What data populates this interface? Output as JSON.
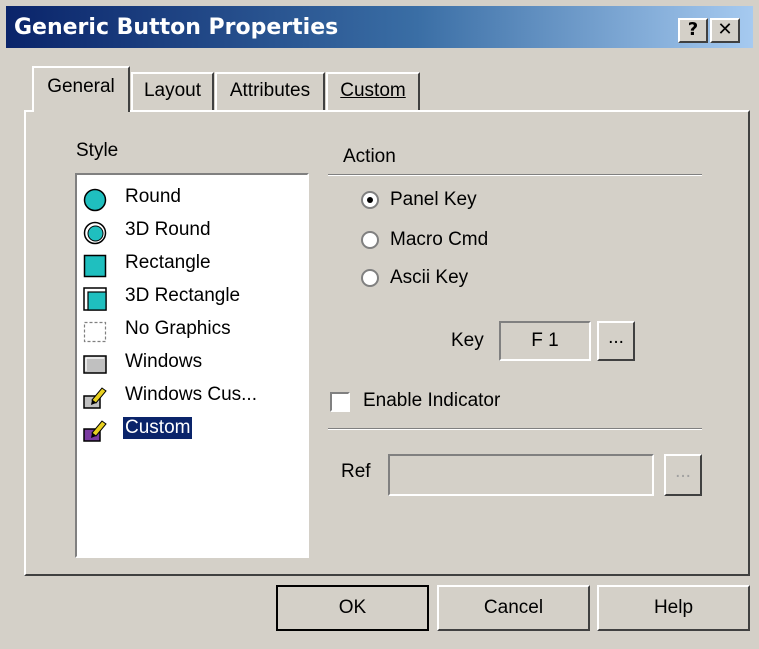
{
  "window": {
    "title": "Generic Button Properties",
    "help_glyph": "?",
    "close_glyph": "✕"
  },
  "tabs": [
    {
      "label": "General",
      "active": true
    },
    {
      "label": "Layout",
      "active": false
    },
    {
      "label": "Attributes",
      "active": false
    },
    {
      "label": "Custom",
      "active": false
    }
  ],
  "style": {
    "label": "Style",
    "items": [
      {
        "label": "Round",
        "icon": "round-icon"
      },
      {
        "label": "3D Round",
        "icon": "3d-round-icon"
      },
      {
        "label": "Rectangle",
        "icon": "rectangle-icon"
      },
      {
        "label": "3D Rectangle",
        "icon": "3d-rectangle-icon"
      },
      {
        "label": "No Graphics",
        "icon": "no-graphics-icon"
      },
      {
        "label": "Windows",
        "icon": "windows-button-icon"
      },
      {
        "label": "Windows Cus...",
        "icon": "windows-custom-icon"
      },
      {
        "label": "Custom",
        "icon": "custom-icon",
        "selected": true
      }
    ]
  },
  "action": {
    "label": "Action",
    "options": [
      {
        "label": "Panel Key",
        "checked": true
      },
      {
        "label": "Macro Cmd",
        "checked": false
      },
      {
        "label": "Ascii Key",
        "checked": false
      }
    ],
    "key_label": "Key",
    "key_value": "F 1",
    "browse_label": "...",
    "enable_indicator_label": "Enable Indicator",
    "enable_indicator_checked": false,
    "ref_label": "Ref",
    "ref_value": "",
    "ref_browse_label": "..."
  },
  "buttons": {
    "ok": "OK",
    "cancel": "Cancel",
    "help": "Help"
  },
  "colors": {
    "face": "#d4d0c8",
    "title_start": "#0a246a",
    "title_end": "#a6caf0",
    "selection": "#0a246a",
    "icon_teal": "#1fbfbf"
  }
}
